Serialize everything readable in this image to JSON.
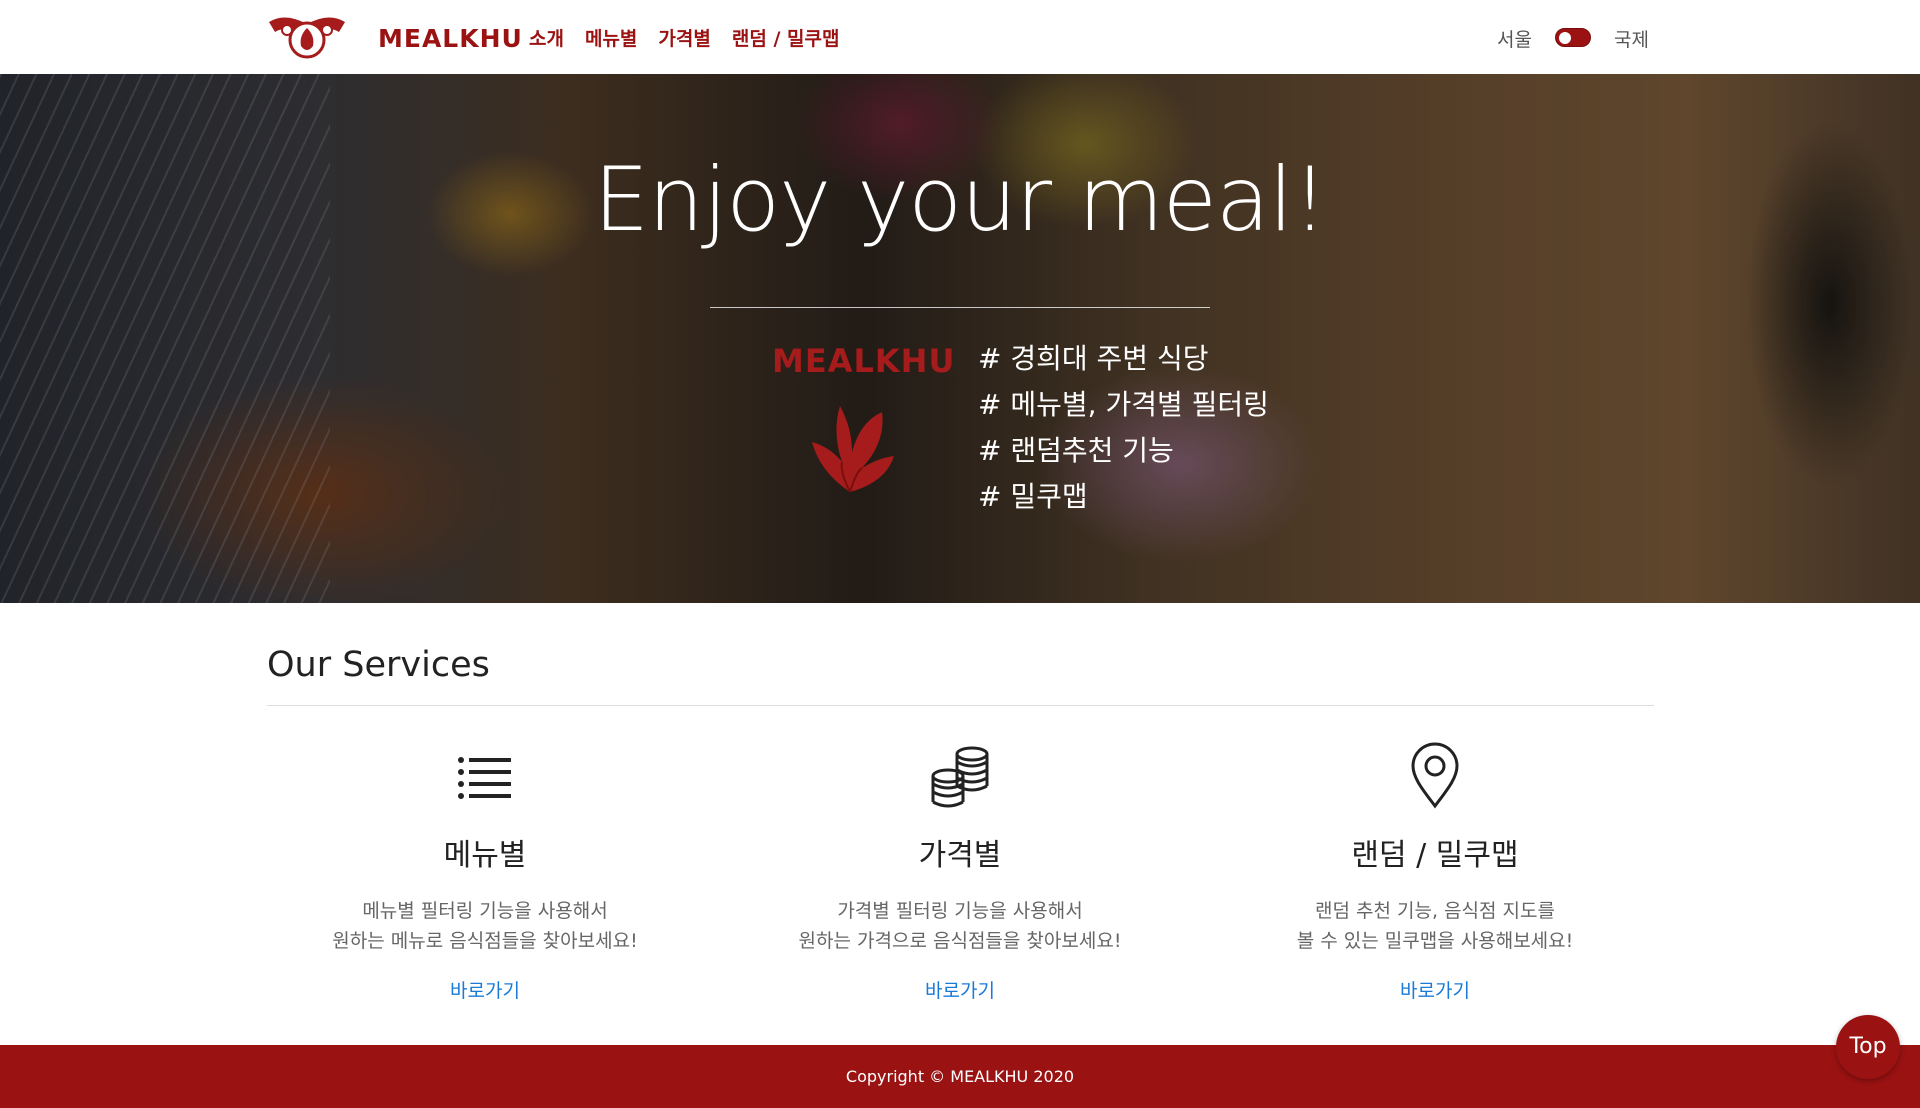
{
  "header": {
    "brand": "MEALKHU",
    "nav": [
      {
        "label": "소개"
      },
      {
        "label": "메뉴별"
      },
      {
        "label": "가격별"
      },
      {
        "label": "랜덤 / 밀쿠맵"
      }
    ],
    "region_left": "서울",
    "region_right": "국제",
    "toggle_on": true
  },
  "hero": {
    "title": "Enjoy your meal!",
    "brand": "MEALKHU",
    "tags": [
      "# 경희대 주변 식당",
      "# 메뉴별, 가격별 필터링",
      "# 랜덤추천 기능",
      "# 밀쿠맵"
    ]
  },
  "services": {
    "title": "Our Services",
    "items": [
      {
        "icon": "list-icon",
        "name": "메뉴별",
        "desc": [
          "메뉴별 필터링 기능을 사용해서",
          "원하는 메뉴로 음식점들을 찾아보세요!"
        ],
        "link": "바로가기"
      },
      {
        "icon": "coins-icon",
        "name": "가격별",
        "desc": [
          "가격별 필터링 기능을 사용해서",
          "원하는 가격으로 음식점들을 찾아보세요!"
        ],
        "link": "바로가기"
      },
      {
        "icon": "map-pin-icon",
        "name": "랜덤 / 밀쿠맵",
        "desc": [
          "랜덤 추천 기능, 음식점 지도를",
          "볼 수 있는 밀쿠맵을 사용해보세요!"
        ],
        "link": "바로가기"
      }
    ]
  },
  "footer": {
    "copyright": "Copyright © MEALKHU 2020"
  },
  "top_button": "Top",
  "colors": {
    "brand": "#9b1212",
    "link": "#1a7ad8"
  }
}
